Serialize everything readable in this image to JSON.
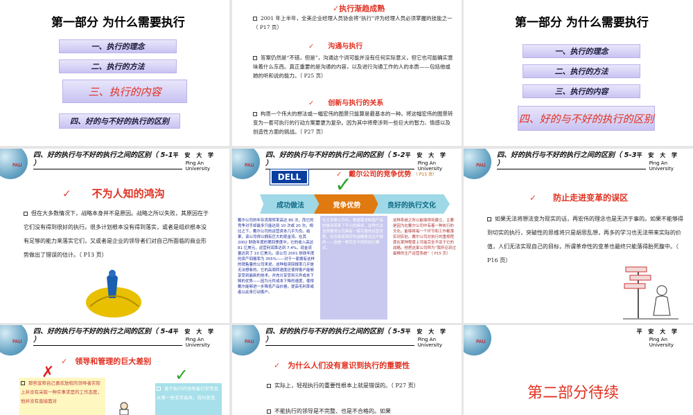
{
  "slide1": {
    "title": "第一部分 为什么需要执行",
    "items": [
      "一、执行的理念",
      "二、执行的方法",
      "三、执行的内容",
      "四、好的与不好的执行的区别"
    ]
  },
  "slide2": {
    "h1": "执行渐趋成熟",
    "p1": "2001 年上半年，全美企业经理人员协会将“执行”评为经理人员必须掌握的技能之一（ P17 页）",
    "h2": "沟通与执行",
    "p2": "答案仍然是“不错，但是”，沟通这个词可能并没有任何实际意义，但它也可能确实意味着什么东西。真正重要的是沟通的内容，以及进行沟通工作的人的本质——包括他或她的听和说的能力。（ P25 页）",
    "h3": "创新与执行的关系",
    "p3": "构思一个伟大的想法或一幅宏伟的图景只能算是最基本的一种。将这幅宏伟的图景转变为一套可执行的行动方案要更为复杂。因为其中将牵涉到一些巨大的智力、情感以及创造性方面的挑战。（ P27 页）"
  },
  "slide3": {
    "title": "第一部分 为什么需要执行",
    "items": [
      "一、执行的理念",
      "二、执行的方法",
      "三、执行的内容",
      "四、好的与不好的执行的区别"
    ]
  },
  "header": {
    "pau": "PAU",
    "uni": "平 安 大 学",
    "uni_en1": "Ping An",
    "uni_en2": "University"
  },
  "slide4": {
    "title": "四、好的执行与不好的执行之间的区别（ 5-1 ）",
    "h": "不为人知的鸿沟",
    "p": "但在大多数情况下，战略本身并不是原因。战略之所以失败，其原因在于它们没有得到很好的执行。很多计划根本没有得到落实，或者是组织根本没有足够的能力来落实它们，又或者是企业的领导者们对自己所面临的商业形势做出了错误的估计。（ P13 页）"
  },
  "slide5": {
    "title": "四、好的执行与不好的执行之间的区别（ 5-2 ）",
    "h": "戴尔公司的竞争优势",
    "pages": "（ P15 页）",
    "logo": "DELL",
    "arrows": [
      "成功做法",
      "竞争优势",
      "良好的执行文化"
    ],
    "col1": "戴尔公司的年存货周转率高达 80 次，而它的竞争对手却最多只能达到 10 次或 20 次。相比之下，戴尔公司的运营资本几乎为负。结果，该公司得以拥有巨大的现金流。在其 2002 财政年度的第四季度中，它的收入高达 81 亿美元，运营利润率达到 7.4%，现金流量达到了 10 亿美元。该公司 2001 财政年度的资产回报率为 355%——对于一家拥有这样的销售量的公司来说，这种投资回报率几乎是无法想象的。它的高周转速度还使得客户能够享受到最新的技术。并充分享受到元件成本下降的优势——因为元件成本下降的速度，使得戴尔能够进一步降低产品价格，提高毛利率或者以此来打动客户。",
    "col2": "在大多数公司中，根据需求制造产品的做法带来了不小的麻烦。这种方法显然要求公司具有一套完善的运营流程，仅仅依靠良好的战略是远远不够的——这是一种完全不同的执行模式。",
    "col3": "这种系统之所以能够得到建立，主要是因为在戴尔公司中有着一种执行的文化。能够将每一个环节和工作都落实到实处。戴尔公司对执行的重视程度在某种程度上可能完全不亚于它的战略。他把这家公司称为“我所见到过最棒的生产运营系统”（ P15 页）"
  },
  "slide6": {
    "title": "四、好的执行与不好的执行之间的区别（ 5-3 ）",
    "h": "防止走进变革的误区",
    "p": "如果无法将想法变为现实的话，再宏伟的理念也是无济于事的。如果不能够得到切实的执行，突破性的思维将只是胡思乱想，再多的学习也无法带来实际的价值，人们无法实现自己的目标，所谓革命性的变革也最终只能落得胎死腹中。（ P16 页）"
  },
  "slide7": {
    "title": "四、好的执行与不好的执行之间的区别（ 5-4 ）",
    "h": "领导和管理的巨大差别",
    "left": "那些宣称自己喜欢放权的领导者实际上并没有采取一种实事求是的工作态度，他并没有直接面对",
    "right": "善于执行的领导者们常常会从事一些非常具体，有时甚至"
  },
  "slide8": {
    "title": "四、好的执行与不好的执行之间的区别（ 5-5 ）",
    "h": "为什么人们没有意识到执行的重要性",
    "p1": "实际上，轻视执行的重要性根本上就是错误的。（ P27 页）",
    "p2": "不能执行的领导是不完整、也是不合格的。如果"
  },
  "slide9": {
    "title": "第二部分待续"
  }
}
